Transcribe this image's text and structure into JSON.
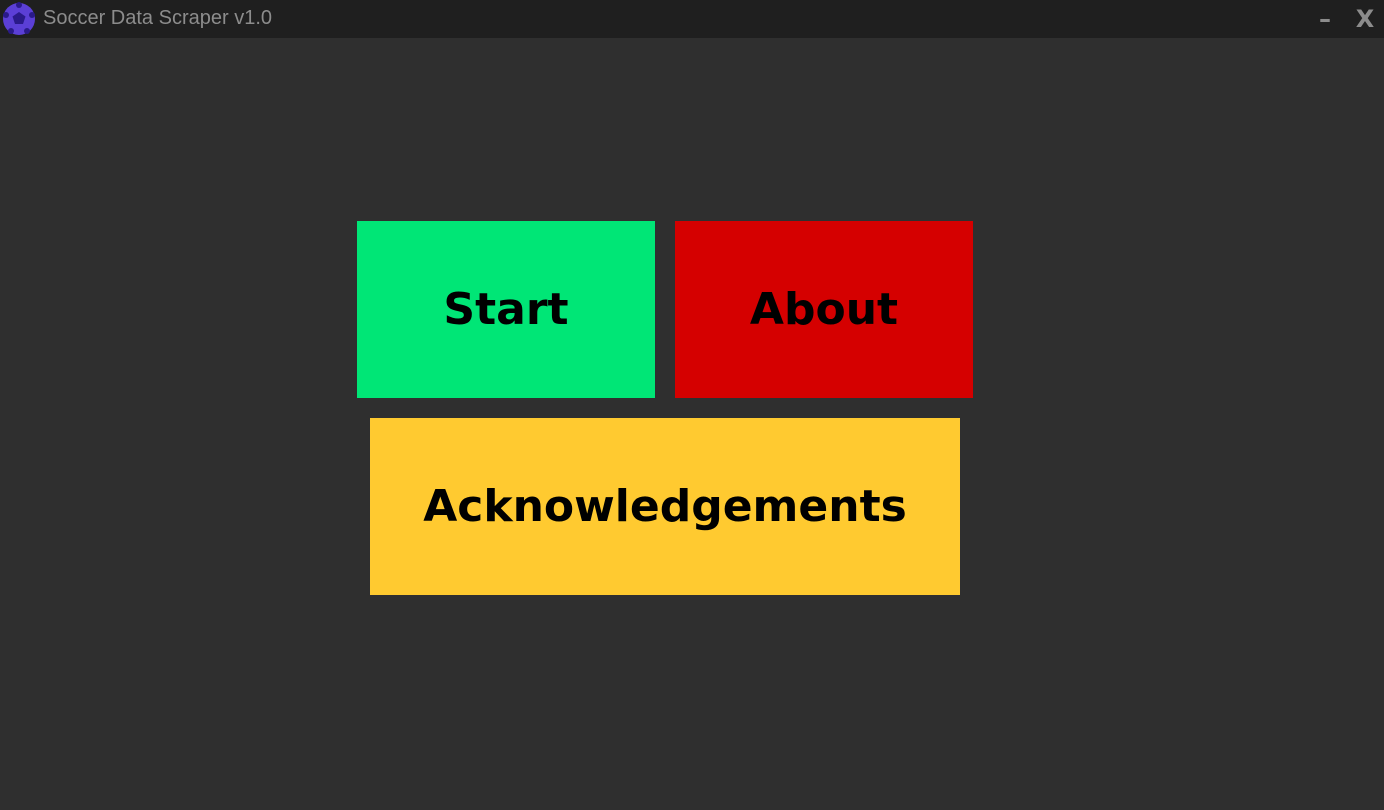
{
  "window": {
    "title": "Soccer Data Scraper v1.0",
    "minimize_label": "–",
    "close_label": "X",
    "app_icon": "soccer-ball-icon"
  },
  "menu": {
    "start_label": "Start",
    "about_label": "About",
    "acknowledgements_label": "Acknowledgements"
  },
  "colors": {
    "background": "#2f2f2f",
    "titlebar": "#1f1f1f",
    "title_text": "#8c8c8c",
    "app_icon": "#5b3fd6",
    "start": "#00e676",
    "about": "#d50000",
    "acknowledgements": "#ffca30",
    "button_text": "#000000"
  }
}
